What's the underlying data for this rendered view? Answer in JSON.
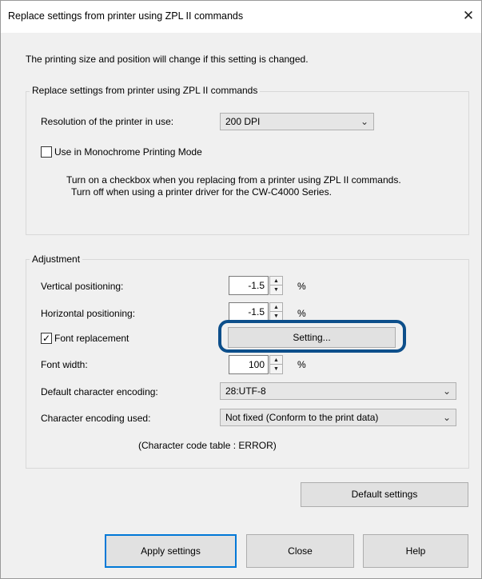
{
  "window": {
    "title": "Replace settings from printer using ZPL II commands",
    "close_glyph": "✕"
  },
  "notice": "The printing size and position will change if this setting is changed.",
  "replace_group": {
    "caption": "Replace settings from printer using ZPL II commands",
    "resolution_label": "Resolution of the printer in use:",
    "resolution_value": "200 DPI",
    "monochrome_label": "Use in Monochrome Printing Mode",
    "monochrome_checked": false,
    "help_line1": "Turn on a checkbox when you replacing from a printer using ZPL II commands.",
    "help_line2": "Turn off when using a printer driver for the CW-C4000 Series."
  },
  "adjustment": {
    "caption": "Adjustment",
    "vertical_label": "Vertical positioning:",
    "vertical_value": "-1.5",
    "horizontal_label": "Horizontal positioning:",
    "horizontal_value": "-1.5",
    "percent_symbol": "%",
    "font_replacement_label": "Font replacement",
    "font_replacement_checked": true,
    "check_glyph": "✓",
    "setting_button": "Setting...",
    "font_width_label": "Font width:",
    "font_width_value": "100",
    "default_encoding_label": "Default character encoding:",
    "default_encoding_value": "28:UTF-8",
    "encoding_used_label": "Character encoding used:",
    "encoding_used_value": "Not fixed (Conform to the print data)",
    "code_table_text": "(Character code table : ERROR)"
  },
  "buttons": {
    "default_settings": "Default settings",
    "apply": "Apply settings",
    "close": "Close",
    "help": "Help"
  },
  "colors": {
    "highlight": "#0d4f8b",
    "focus": "#0078d7"
  }
}
